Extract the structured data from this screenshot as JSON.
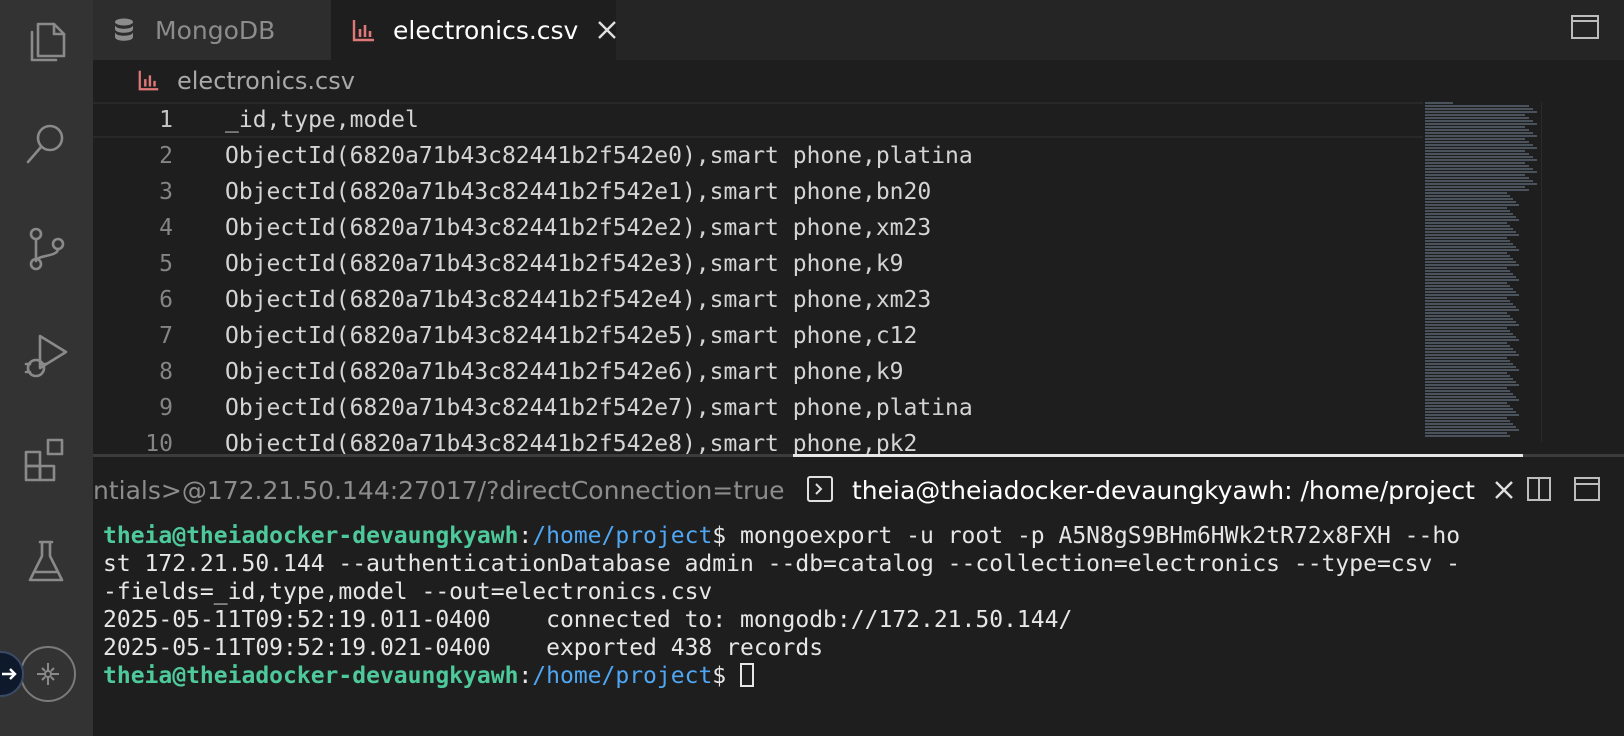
{
  "tabs": {
    "mongo_label": "MongoDB",
    "csv_label": "electronics.csv"
  },
  "breadcrumb": {
    "file": "electronics.csv"
  },
  "editor": {
    "lines": [
      {
        "num": "1",
        "text": "_id,type,model"
      },
      {
        "num": "2",
        "text": "ObjectId(6820a71b43c82441b2f542e0),smart phone,platina"
      },
      {
        "num": "3",
        "text": "ObjectId(6820a71b43c82441b2f542e1),smart phone,bn20"
      },
      {
        "num": "4",
        "text": "ObjectId(6820a71b43c82441b2f542e2),smart phone,xm23"
      },
      {
        "num": "5",
        "text": "ObjectId(6820a71b43c82441b2f542e3),smart phone,k9"
      },
      {
        "num": "6",
        "text": "ObjectId(6820a71b43c82441b2f542e4),smart phone,xm23"
      },
      {
        "num": "7",
        "text": "ObjectId(6820a71b43c82441b2f542e5),smart phone,c12"
      },
      {
        "num": "8",
        "text": "ObjectId(6820a71b43c82441b2f542e6),smart phone,k9"
      },
      {
        "num": "9",
        "text": "ObjectId(6820a71b43c82441b2f542e7),smart phone,platina"
      },
      {
        "num": "10",
        "text": "ObjectId(6820a71b43c82441b2f542e8),smart phone,pk2"
      }
    ]
  },
  "terminal_tabs": {
    "left_label": "ntials>@172.21.50.144:27017/?directConnection=true",
    "right_label": "theia@theiadocker-devaungkyawh: /home/project"
  },
  "terminal": {
    "prompt_user": "theia@theiadocker-devaungkyawh",
    "prompt_colon": ":",
    "prompt_path": "/home/project",
    "prompt_dollar": "$ ",
    "cmd_line1": "mongoexport -u root -p A5N8gS9BHm6HWk2tR72x8FXH --ho",
    "cmd_line2": "st 172.21.50.144 --authenticationDatabase admin --db=catalog --collection=electronics --type=csv -",
    "cmd_line3": "-fields=_id,type,model --out=electronics.csv",
    "log_line1": "2025-05-11T09:52:19.011-0400    connected to: mongodb://172.21.50.144/",
    "log_line2": "2025-05-11T09:52:19.021-0400    exported 438 records"
  },
  "colors": {
    "prompt_user": "#4ec99b",
    "prompt_path": "#4fa6f2",
    "csv_icon": "#e0787a"
  }
}
